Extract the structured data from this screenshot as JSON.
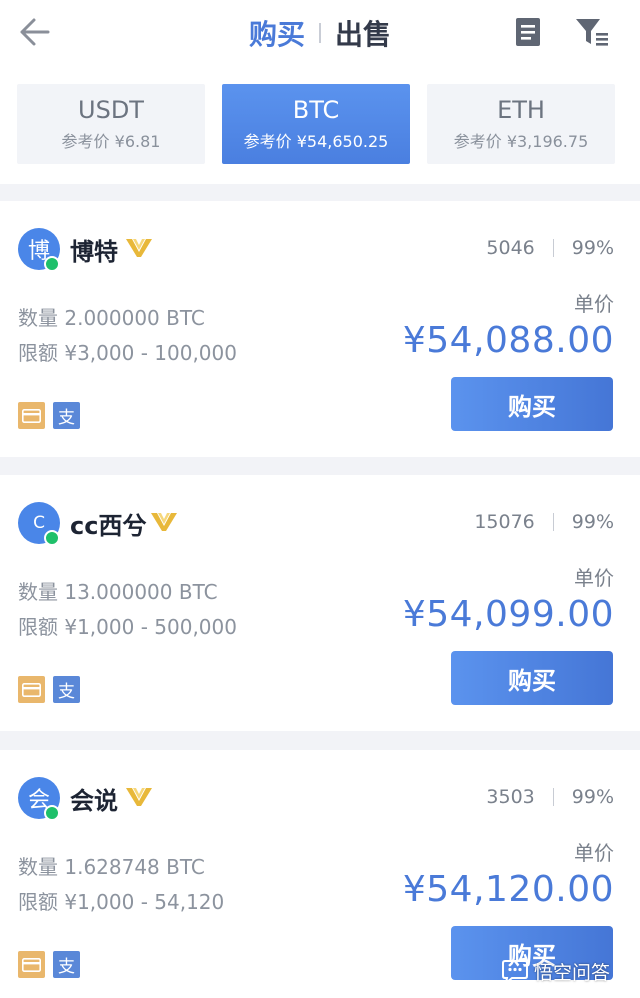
{
  "header": {
    "tab_buy": "购买",
    "tab_sell": "出售",
    "icons": {
      "back": "arrow-left-icon",
      "orders": "document-icon",
      "filter": "filter-icon"
    }
  },
  "coins": [
    {
      "name": "USDT",
      "price": "参考价 ¥6.81",
      "active": false
    },
    {
      "name": "BTC",
      "price": "参考价 ¥54,650.25",
      "active": true
    },
    {
      "name": "ETH",
      "price": "参考价 ¥3,196.75",
      "active": false
    }
  ],
  "listings": [
    {
      "avatar": "博",
      "name": "博特",
      "orders": "5046",
      "rate": "99%",
      "quantity": "数量 2.000000  BTC",
      "limit": "限额 ¥3,000 - 100,000",
      "price_label": "单价",
      "price": "¥54,088.00",
      "buy_label": "购买",
      "pay_alipay": "支"
    },
    {
      "avatar": "C",
      "name": "cc西兮",
      "orders": "15076",
      "rate": "99%",
      "quantity": "数量 13.000000  BTC",
      "limit": "限额 ¥1,000 - 500,000",
      "price_label": "单价",
      "price": "¥54,099.00",
      "buy_label": "购买",
      "pay_alipay": "支"
    },
    {
      "avatar": "会",
      "name": "会说",
      "orders": "3503",
      "rate": "99%",
      "quantity": "数量 1.628748  BTC",
      "limit": "限额 ¥1,000 - 54,120",
      "price_label": "单价",
      "price": "¥54,120.00",
      "buy_label": "购买",
      "pay_alipay": "支"
    }
  ],
  "watermark": {
    "text": "悟空问答"
  },
  "colors": {
    "accent": "#4a7ad8",
    "online": "#1fc06a",
    "vip_gold": "#e8b83a",
    "bankcard": "#e9b76c",
    "alipay": "#5a88d8"
  }
}
